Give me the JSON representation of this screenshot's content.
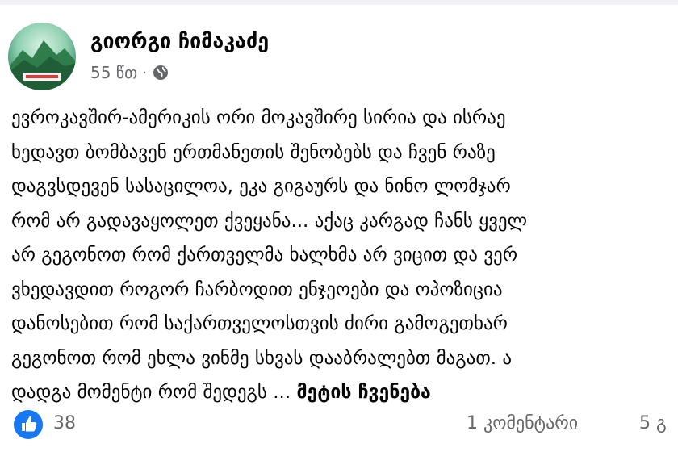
{
  "post": {
    "author": "გიორგი ჩიმაკაძე",
    "time": "55 წთ",
    "separator": "·",
    "privacy_icon": "globe-icon",
    "avatar_icon": "mountain-avatar",
    "lines": [
      "ევროკავშირ-ამერიკის ორი მოკავშირე სირია და ისრაე",
      "ხედავთ ბომბავენ ერთმანეთის შენობებს და ჩვენ რაზე",
      "დაგვსდევენ სასაცილოა, ეკა გიგაურს და ნინო ლომჯარ",
      "რომ არ გადავაყოლეთ ქვეყანა... აქაც კარგად ჩანს ყველ",
      "არ გეგონოთ რომ ქართველმა ხალხმა არ ვიცით და ვერ",
      "ვხედავდით როგორ ჩარბოდით ენჯეოები და ოპოზიცია",
      "დანოსებით რომ საქართველოსთვის ძირი გამოგეთხარ",
      "გეგონოთ რომ ეხლა ვინმე სხვას დააბრალებთ მაგათ. ა"
    ],
    "last_line": "დადგა მომენტი რომ შედეგს ...",
    "see_more": "მეტის ჩვენება"
  },
  "footer": {
    "reaction_icon": "like-icon",
    "likes": "38",
    "comments": "1 კომენტარი",
    "shares": "5 გ"
  },
  "colors": {
    "like_blue": "#1877f2",
    "secondary_text": "#65676b",
    "text": "#050505"
  }
}
